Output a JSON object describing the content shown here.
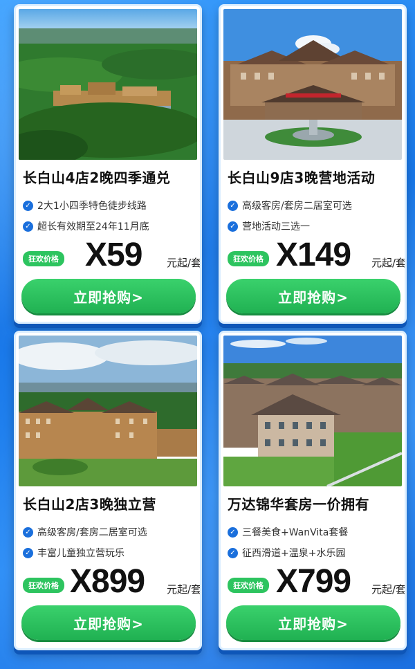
{
  "cards": [
    {
      "title": "长白山4店2晚四季通兑",
      "features": [
        "2大1小四季特色徒步线路",
        "超长有效期至24年11月底"
      ],
      "badge": "狂欢价格",
      "price": "X59",
      "unit": "元起/套",
      "button": "立即抢购>"
    },
    {
      "title": "长白山9店3晚营地活动",
      "features": [
        "高级客房/套房二居室可选",
        "营地活动三选一"
      ],
      "badge": "狂欢价格",
      "price": "X149",
      "unit": "元起/套",
      "button": "立即抢购>"
    },
    {
      "title": "长白山2店3晚独立营",
      "features": [
        "高级客房/套房二居室可选",
        "丰富儿童独立营玩乐"
      ],
      "badge": "狂欢价格",
      "price": "X899",
      "unit": "元起/套",
      "button": "立即抢购>"
    },
    {
      "title": "万达锦华套房一价拥有",
      "features": [
        "三餐美食+WanVita套餐",
        "征西滑道+温泉+水乐园"
      ],
      "badge": "狂欢价格",
      "price": "X799",
      "unit": "元起/套",
      "button": "立即抢购>"
    }
  ],
  "icons": {
    "feature": "check-circle-icon"
  },
  "colors": {
    "accent_green": "#2dc45f",
    "check_blue": "#1a6fdc",
    "background_blue": "#1877e8"
  }
}
